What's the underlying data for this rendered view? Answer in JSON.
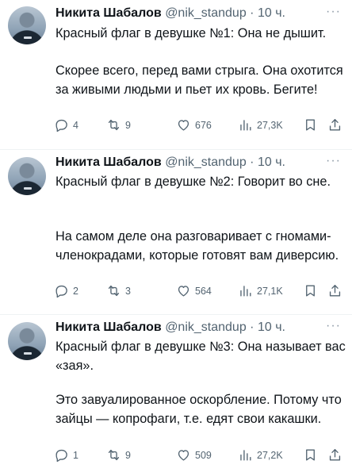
{
  "tweets": [
    {
      "name": "Никита Шабалов",
      "handle": "@nik_standup",
      "separator": "·",
      "time": "10 ч.",
      "more": "···",
      "line1": "Красный флаг в девушке №1: Она не дышит.",
      "para2": "Скорее всего, перед вами стрыга. Она охотится за живыми людьми и пьет их кровь. Бегите!",
      "replies": "4",
      "retweets": "9",
      "likes": "676",
      "views": "27,3K"
    },
    {
      "name": "Никита Шабалов",
      "handle": "@nik_standup",
      "separator": "·",
      "time": "10 ч.",
      "more": "···",
      "line1": "Красный флаг в девушке №2: Говорит во сне.",
      "para2": "На самом деле она разговаривает с гномами-членокрадами, которые готовят вам диверсию.",
      "replies": "2",
      "retweets": "3",
      "likes": "564",
      "views": "27,1K"
    },
    {
      "name": "Никита Шабалов",
      "handle": "@nik_standup",
      "separator": "·",
      "time": "10 ч.",
      "more": "···",
      "line1": "Красный флаг в девушке №3: Она называет вас «зая».",
      "para2": "Это завуалированное оскорбление. Потому что зайцы — копрофаги, т.е. едят свои какашки.",
      "replies": "1",
      "retweets": "9",
      "likes": "509",
      "views": "27,2K"
    }
  ],
  "icons": [
    "reply-icon",
    "retweet-icon",
    "like-icon",
    "views-icon",
    "bookmark-icon",
    "share-icon"
  ]
}
